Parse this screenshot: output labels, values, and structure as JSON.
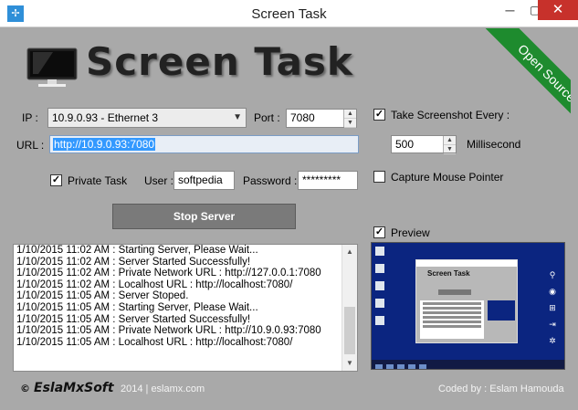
{
  "window": {
    "title": "Screen Task",
    "app_icon": "screen-task-icon",
    "controls": {
      "minimize": "─",
      "maximize": "▢",
      "close": "✕"
    }
  },
  "header": {
    "logo_text": "Screen Task",
    "ribbon_text": "Open Source",
    "ribbon_color": "#1e8b2e"
  },
  "form": {
    "ip_label": "IP :",
    "ip_value": "10.9.0.93 - Ethernet 3",
    "port_label": "Port :",
    "port_value": "7080",
    "url_label": "URL :",
    "url_value": "http://10.9.0.93:7080",
    "private_task": {
      "label": "Private Task",
      "checked": true
    },
    "user_label": "User :",
    "user_value": "softpedia",
    "password_label": "Password :",
    "password_value": "*********",
    "stop_button_label": "Stop Server"
  },
  "options": {
    "take_screenshot": {
      "label": "Take Screenshot Every :",
      "checked": true
    },
    "interval_value": "500",
    "interval_unit": "Millisecond",
    "capture_mouse": {
      "label": "Capture Mouse Pointer",
      "checked": false
    },
    "preview": {
      "label": "Preview",
      "checked": true
    }
  },
  "log": {
    "lines": [
      "1/10/2015 11:02 AM : Starting Server, Please Wait...",
      "1/10/2015 11:02 AM : Server Started Successfully!",
      "1/10/2015 11:02 AM : Private Network URL : http://127.0.0.1:7080",
      "1/10/2015 11:02 AM : Localhost URL : http://localhost:7080/",
      "1/10/2015 11:05 AM : Server Stoped.",
      "1/10/2015 11:05 AM : Starting Server, Please Wait...",
      "1/10/2015 11:05 AM : Server Started Successfully!",
      "1/10/2015 11:05 AM : Private Network URL : http://10.9.0.93:7080",
      "1/10/2015 11:05 AM : Localhost URL : http://localhost:7080/"
    ]
  },
  "preview_image": {
    "window_title": "Screen Task"
  },
  "footer": {
    "copyright_symbol": "©",
    "brand": "EslaMxSoft",
    "year_site": "2014 | eslamx.com",
    "credit": "Coded by : Eslam Hamouda"
  }
}
